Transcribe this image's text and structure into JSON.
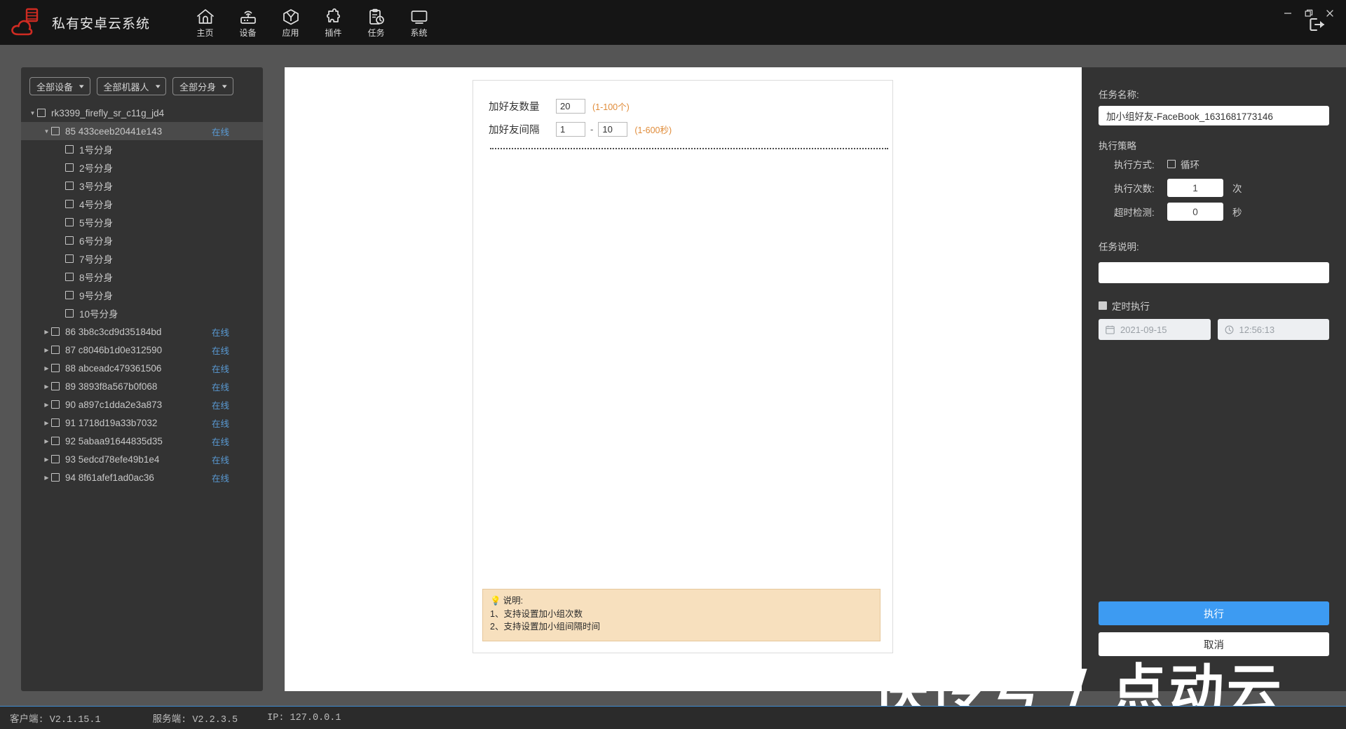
{
  "titlebar": {
    "app_title": "私有安卓云系统",
    "logo_icon": "cloud-server-logo",
    "nav": [
      {
        "label": "主页",
        "icon": "home-icon"
      },
      {
        "label": "设备",
        "icon": "router-icon"
      },
      {
        "label": "应用",
        "icon": "cube-icon"
      },
      {
        "label": "插件",
        "icon": "puzzle-icon"
      },
      {
        "label": "任务",
        "icon": "clipboard-clock-icon"
      },
      {
        "label": "系统",
        "icon": "monitor-icon"
      }
    ],
    "logout_icon": "logout-icon",
    "minimize": "—",
    "maximize": "❐",
    "close": "✕"
  },
  "sidebar": {
    "filters": [
      {
        "label": "全部设备",
        "icon": "chevron-down-icon"
      },
      {
        "label": "全部机器人",
        "icon": "chevron-down-icon"
      },
      {
        "label": "全部分身",
        "icon": "chevron-down-icon"
      }
    ],
    "tree": [
      {
        "label": "rk3399_firefly_sr_c11g_jd4",
        "indent": 0,
        "arrow": "down",
        "status": "",
        "selected": false
      },
      {
        "label": "85 433ceeb20441e143",
        "indent": 1,
        "arrow": "down",
        "status": "在线",
        "selected": true
      },
      {
        "label": "1号分身",
        "indent": 2,
        "arrow": "none",
        "status": "",
        "selected": false
      },
      {
        "label": "2号分身",
        "indent": 2,
        "arrow": "none",
        "status": "",
        "selected": false
      },
      {
        "label": "3号分身",
        "indent": 2,
        "arrow": "none",
        "status": "",
        "selected": false
      },
      {
        "label": "4号分身",
        "indent": 2,
        "arrow": "none",
        "status": "",
        "selected": false
      },
      {
        "label": "5号分身",
        "indent": 2,
        "arrow": "none",
        "status": "",
        "selected": false
      },
      {
        "label": "6号分身",
        "indent": 2,
        "arrow": "none",
        "status": "",
        "selected": false
      },
      {
        "label": "7号分身",
        "indent": 2,
        "arrow": "none",
        "status": "",
        "selected": false
      },
      {
        "label": "8号分身",
        "indent": 2,
        "arrow": "none",
        "status": "",
        "selected": false
      },
      {
        "label": "9号分身",
        "indent": 2,
        "arrow": "none",
        "status": "",
        "selected": false
      },
      {
        "label": "10号分身",
        "indent": 2,
        "arrow": "none",
        "status": "",
        "selected": false
      },
      {
        "label": "86 3b8c3cd9d35184bd",
        "indent": 1,
        "arrow": "right",
        "status": "在线",
        "selected": false
      },
      {
        "label": "87 c8046b1d0e312590",
        "indent": 1,
        "arrow": "right",
        "status": "在线",
        "selected": false
      },
      {
        "label": "88 abceadc479361506",
        "indent": 1,
        "arrow": "right",
        "status": "在线",
        "selected": false
      },
      {
        "label": "89 3893f8a567b0f068",
        "indent": 1,
        "arrow": "right",
        "status": "在线",
        "selected": false
      },
      {
        "label": "90 a897c1dda2e3a873",
        "indent": 1,
        "arrow": "right",
        "status": "在线",
        "selected": false
      },
      {
        "label": "91 1718d19a33b7032",
        "indent": 1,
        "arrow": "right",
        "status": "在线",
        "selected": false
      },
      {
        "label": "92 5abaa91644835d35",
        "indent": 1,
        "arrow": "right",
        "status": "在线",
        "selected": false
      },
      {
        "label": "93 5edcd78efe49b1e4",
        "indent": 1,
        "arrow": "right",
        "status": "在线",
        "selected": false
      },
      {
        "label": "94 8f61afef1ad0ac36",
        "indent": 1,
        "arrow": "right",
        "status": "在线",
        "selected": false
      }
    ]
  },
  "main": {
    "count_label": "加好友数量",
    "count_value": "20",
    "count_hint": "(1-100个)",
    "interval_label": "加好友间隔",
    "interval_min": "1",
    "interval_dash": "-",
    "interval_max": "10",
    "interval_hint": "(1-600秒)",
    "note": {
      "icon": "lightbulb-icon",
      "title": "说明:",
      "lines": [
        "1、支持设置加小组次数",
        "2、支持设置加小组间隔时间"
      ]
    }
  },
  "rightpanel": {
    "task_name_label": "任务名称:",
    "task_name_value": "加小组好友-FaceBook_1631681773146",
    "strategy_title": "执行策略",
    "mode_label": "执行方式:",
    "mode_option": "循环",
    "mode_checked": false,
    "times_label": "执行次数:",
    "times_value": "1",
    "times_unit": "次",
    "timeout_label": "超时检测:",
    "timeout_value": "0",
    "timeout_unit": "秒",
    "desc_label": "任务说明:",
    "desc_value": "",
    "desc_placeholder": "",
    "schedule_label": "定时执行",
    "schedule_checked": false,
    "date_icon": "calendar-icon",
    "date_value": "2021-09-15",
    "time_icon": "clock-icon",
    "time_value": "12:56:13",
    "execute_label": "执行",
    "cancel_label": "取消",
    "accent_color": "#3d9bf2"
  },
  "watermark": {
    "text": "快传号 / 点动云"
  },
  "statusbar": {
    "client": "客户端: V2.1.15.1",
    "server": "服务端: V2.2.3.5",
    "ip": "IP: 127.0.0.1",
    "accent_color": "#3f8bd0"
  }
}
